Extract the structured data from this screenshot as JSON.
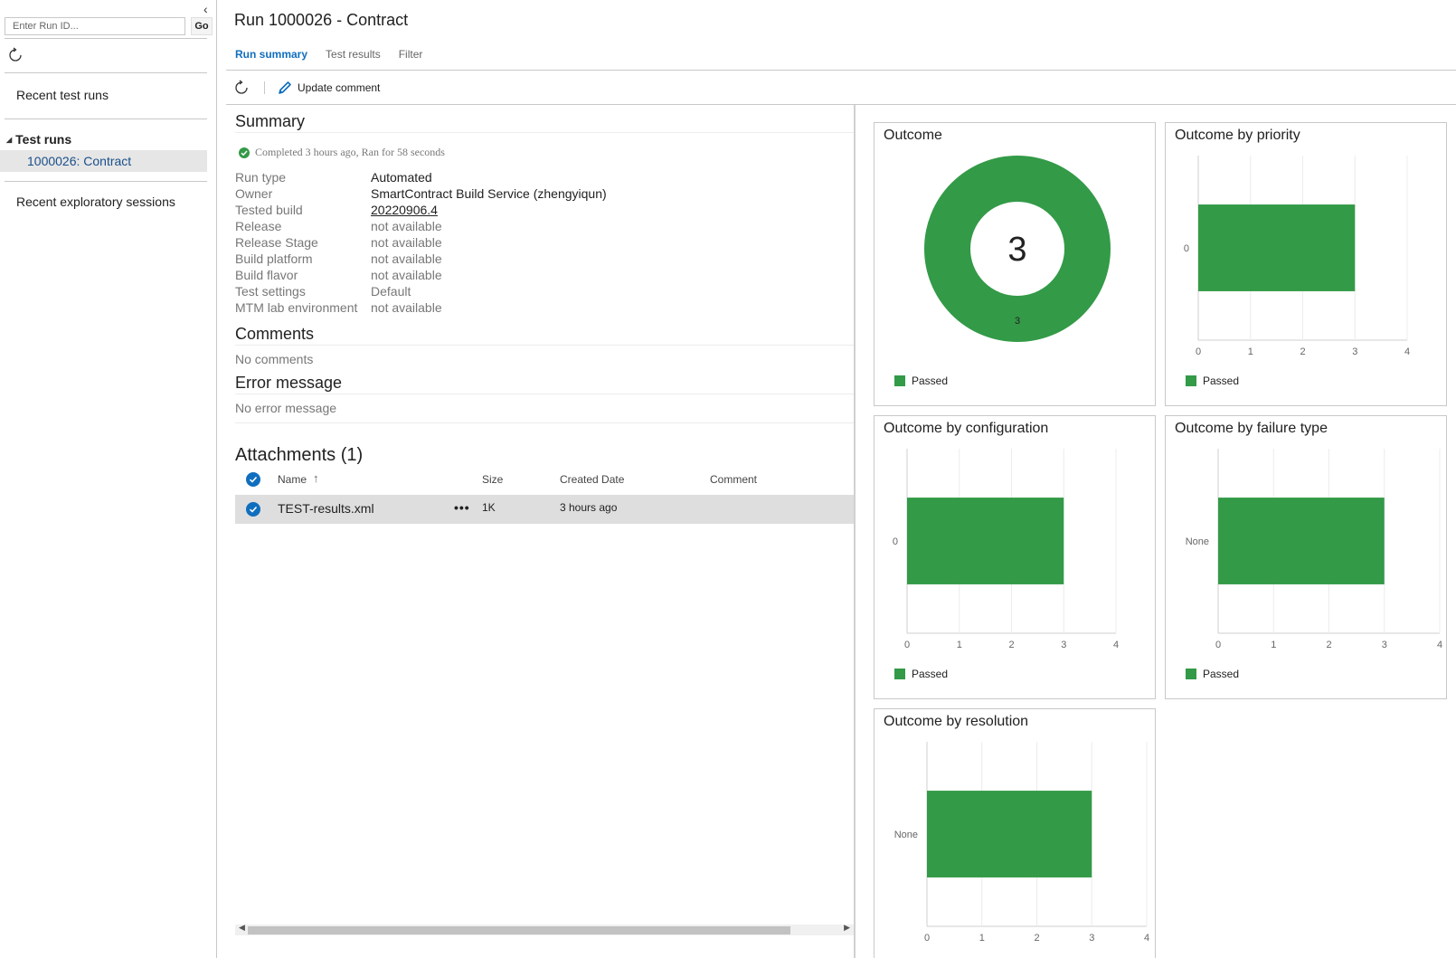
{
  "left_pane": {
    "run_id_placeholder": "Enter Run ID...",
    "go_label": "Go",
    "recent_test_runs": "Recent test runs",
    "test_runs_header": "Test runs",
    "selected_run": "1000026: Contract",
    "recent_exploratory": "Recent exploratory sessions"
  },
  "header": {
    "title": "Run 1000026 - Contract",
    "tabs": [
      {
        "label": "Run summary",
        "active": true
      },
      {
        "label": "Test results",
        "active": false
      },
      {
        "label": "Filter",
        "active": false
      }
    ]
  },
  "toolbar": {
    "update_comment": "Update comment"
  },
  "summary": {
    "title": "Summary",
    "status": "Completed 3 hours ago, Ran for 58 seconds",
    "fields": [
      {
        "label": "Run type",
        "value": "Automated"
      },
      {
        "label": "Owner",
        "value": "SmartContract Build Service (zhengyiqun)"
      },
      {
        "label": "Tested build",
        "value": "20220906.4"
      },
      {
        "label": "Release",
        "value": "not available"
      },
      {
        "label": "Release Stage",
        "value": "not available"
      },
      {
        "label": "Build platform",
        "value": "not available"
      },
      {
        "label": "Build flavor",
        "value": "not available"
      },
      {
        "label": "Test settings",
        "value": "Default"
      },
      {
        "label": "MTM lab environment",
        "value": "not available"
      }
    ],
    "comments_title": "Comments",
    "comments_text": "No comments",
    "error_title": "Error message",
    "error_text": "No error message"
  },
  "attachments": {
    "title": "Attachments (1)",
    "columns": {
      "name": "Name",
      "sort_arrow": "↑",
      "size": "Size",
      "created": "Created Date",
      "comment": "Comment"
    },
    "rows": [
      {
        "name": "TEST-results.xml",
        "more": "•••",
        "size": "1K",
        "created": "3 hours ago",
        "comment": ""
      }
    ]
  },
  "colors": {
    "passed": "#339a47",
    "accent": "#106ebe"
  },
  "icons": [
    "refresh-icon",
    "pencil-icon",
    "check-circle-icon",
    "collapse-chevron-icon"
  ],
  "chart_data": [
    {
      "type": "pie",
      "title": "Outcome",
      "center_label": "3",
      "slices": [
        {
          "name": "Passed",
          "value": 3
        }
      ],
      "legend": [
        "Passed"
      ]
    },
    {
      "type": "bar",
      "title": "Outcome by priority",
      "categories": [
        "0"
      ],
      "series": [
        {
          "name": "Passed",
          "values": [
            3
          ]
        }
      ],
      "xlim": [
        0,
        4
      ],
      "xticks": [
        "0",
        "1",
        "2",
        "3",
        "4"
      ],
      "legend": [
        "Passed"
      ]
    },
    {
      "type": "bar",
      "title": "Outcome by configuration",
      "categories": [
        "0"
      ],
      "series": [
        {
          "name": "Passed",
          "values": [
            3
          ]
        }
      ],
      "xlim": [
        0,
        4
      ],
      "xticks": [
        "0",
        "1",
        "2",
        "3",
        "4"
      ],
      "legend": [
        "Passed"
      ]
    },
    {
      "type": "bar",
      "title": "Outcome by failure type",
      "categories": [
        "None"
      ],
      "series": [
        {
          "name": "Passed",
          "values": [
            3
          ]
        }
      ],
      "xlim": [
        0,
        4
      ],
      "xticks": [
        "0",
        "1",
        "2",
        "3",
        "4"
      ],
      "legend": [
        "Passed"
      ]
    },
    {
      "type": "bar",
      "title": "Outcome by resolution",
      "categories": [
        "None"
      ],
      "series": [
        {
          "name": "Passed",
          "values": [
            3
          ]
        }
      ],
      "xlim": [
        0,
        4
      ],
      "xticks": [
        "0",
        "1",
        "2",
        "3",
        "4"
      ],
      "legend": []
    }
  ]
}
